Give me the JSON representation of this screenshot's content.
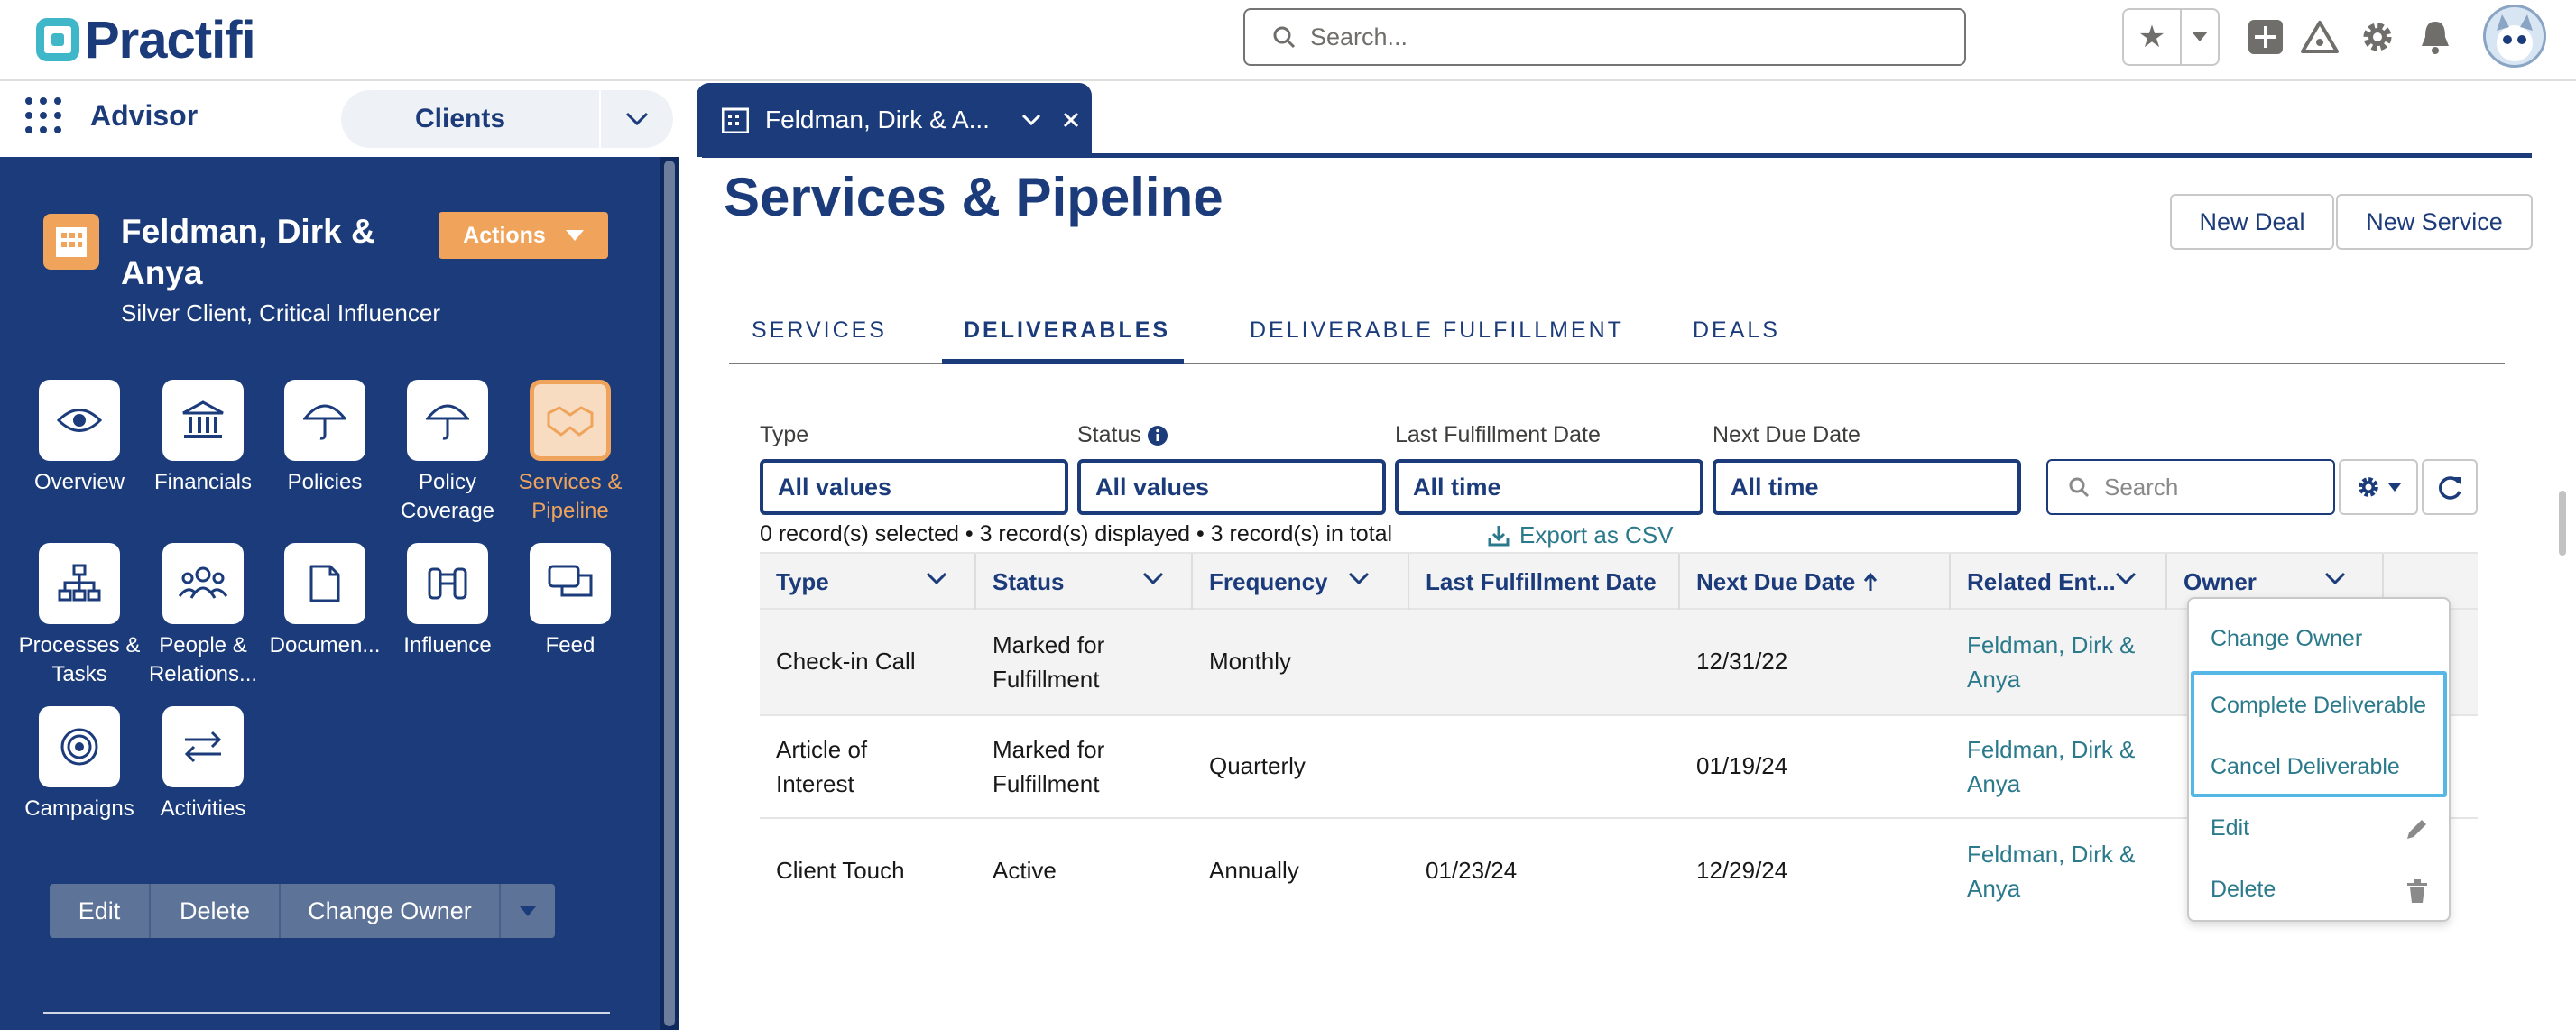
{
  "brand": {
    "name": "Practifi"
  },
  "header": {
    "search_placeholder": "Search..."
  },
  "appbar": {
    "app_name": "Advisor",
    "object": "Clients",
    "record_tab": "Feldman, Dirk & A..."
  },
  "account": {
    "name": "Feldman, Dirk & Anya",
    "subtitle": "Silver Client, Critical Influencer",
    "actions_label": "Actions"
  },
  "tiles": [
    {
      "label": "Overview",
      "icon": "eye-icon"
    },
    {
      "label": "Financials",
      "icon": "bank-icon"
    },
    {
      "label": "Policies",
      "icon": "umbrella-icon"
    },
    {
      "label": "Policy Coverage",
      "icon": "umbrella-icon"
    },
    {
      "label": "Services & Pipeline",
      "icon": "handshake-icon",
      "active": true
    },
    {
      "label": "Processes & Tasks",
      "icon": "hierarchy-icon"
    },
    {
      "label": "People & Relations...",
      "icon": "people-icon"
    },
    {
      "label": "Documen...",
      "icon": "document-icon"
    },
    {
      "label": "Influence",
      "icon": "binoculars-icon"
    },
    {
      "label": "Feed",
      "icon": "chat-icon"
    },
    {
      "label": "Campaigns",
      "icon": "target-icon"
    },
    {
      "label": "Activities",
      "icon": "arrows-icon"
    }
  ],
  "sidebar_buttons": {
    "edit": "Edit",
    "delete": "Delete",
    "change_owner": "Change Owner"
  },
  "page": {
    "title": "Services & Pipeline",
    "new_deal": "New Deal",
    "new_service": "New Service"
  },
  "tabs": [
    "SERVICES",
    "DELIVERABLES",
    "DELIVERABLE FULFILLMENT",
    "DEALS"
  ],
  "active_tab": "DELIVERABLES",
  "filters": [
    {
      "label": "Type",
      "value": "All values"
    },
    {
      "label": "Status",
      "value": "All values"
    },
    {
      "label": "Last Fulfillment Date",
      "value": "All time"
    },
    {
      "label": "Next Due Date",
      "value": "All time"
    }
  ],
  "table_search_placeholder": "Search",
  "summary": "0 record(s) selected • 3 record(s) displayed • 3 record(s) in total",
  "export_label": "Export as CSV",
  "columns": [
    "Type",
    "Status",
    "Frequency",
    "Last Fulfillment Date",
    "Next Due Date",
    "Related Ent...",
    "Owner"
  ],
  "rows": [
    {
      "type": "Check-in Call",
      "status": "Marked for Fulfillment",
      "frequency": "Monthly",
      "last": "",
      "next": "12/31/22",
      "related": "Feldman, Dirk & Anya"
    },
    {
      "type": "Article of Interest",
      "status": "Marked for Fulfillment",
      "frequency": "Quarterly",
      "last": "",
      "next": "01/19/24",
      "related": "Feldman, Dirk & Anya"
    },
    {
      "type": "Client Touch",
      "status": "Active",
      "frequency": "Annually",
      "last": "01/23/24",
      "next": "12/29/24",
      "related": "Feldman, Dirk & Anya"
    }
  ],
  "row_menu": [
    "Change Owner",
    "Complete Deliverable",
    "Cancel Deliverable",
    "Edit",
    "Delete"
  ],
  "colors": {
    "navy": "#1b3b7a",
    "orange": "#f0a45b",
    "teal": "#2b7a8c",
    "focus": "#55b7e6"
  }
}
